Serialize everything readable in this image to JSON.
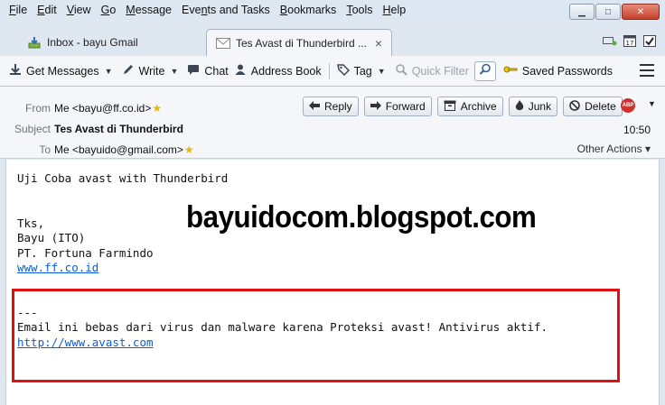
{
  "menubar": {
    "items": [
      {
        "u": "F",
        "rest": "ile"
      },
      {
        "u": "E",
        "rest": "dit"
      },
      {
        "u": "V",
        "rest": "iew"
      },
      {
        "u": "G",
        "rest": "o"
      },
      {
        "u": "M",
        "rest": "essage"
      },
      {
        "u": "",
        "pre": "Eve",
        "u2": "n",
        "rest": "ts and Tasks"
      },
      {
        "u": "B",
        "rest": "ookmarks"
      },
      {
        "u": "T",
        "rest": "ools"
      },
      {
        "u": "H",
        "rest": "elp"
      }
    ],
    "window_controls": [
      "minimize-icon",
      "maximize-icon",
      "close-icon"
    ]
  },
  "tabs": [
    {
      "label": "Inbox - bayu Gmail",
      "icon": "inbox-download-icon",
      "active": false
    },
    {
      "label": "Tes  Avast di Thunderbird ...",
      "icon": "envelope-icon",
      "active": true,
      "close": "×"
    }
  ],
  "toolbar": {
    "get_messages": "Get Messages",
    "write": "Write",
    "chat": "Chat",
    "address_book": "Address Book",
    "tag": "Tag",
    "quick_filter": "Quick Filter",
    "saved_passwords": "Saved Passwords"
  },
  "header": {
    "from_label": "From",
    "from_value": "Me <bayu@ff.co.id>",
    "subject_label": "Subject",
    "subject_value": "Tes Avast di Thunderbird",
    "to_label": "To",
    "to_value": "Me <bayuido@gmail.com>",
    "time": "10:50",
    "other_actions": "Other Actions ▾",
    "abp": "ABP",
    "actions": {
      "reply": "Reply",
      "forward": "Forward",
      "archive": "Archive",
      "junk": "Junk",
      "delete": "Delete"
    }
  },
  "body": {
    "line1": "Uji Coba avast with Thunderbird",
    "sig_tks": "Tks,",
    "sig_name": "Bayu (ITO)",
    "sig_company": "PT. Fortuna Farmindo",
    "sig_link": "www.ff.co.id",
    "separator": "---",
    "avast_note": "Email ini bebas dari virus dan malware karena Proteksi avast! Antivirus aktif.",
    "avast_link": "http://www.avast.com",
    "watermark": "bayuidocom.blogspot.com"
  },
  "colors": {
    "highlight_box": "#e01010",
    "link": "#0b5ed7",
    "chrome": "#dfe7f1"
  }
}
